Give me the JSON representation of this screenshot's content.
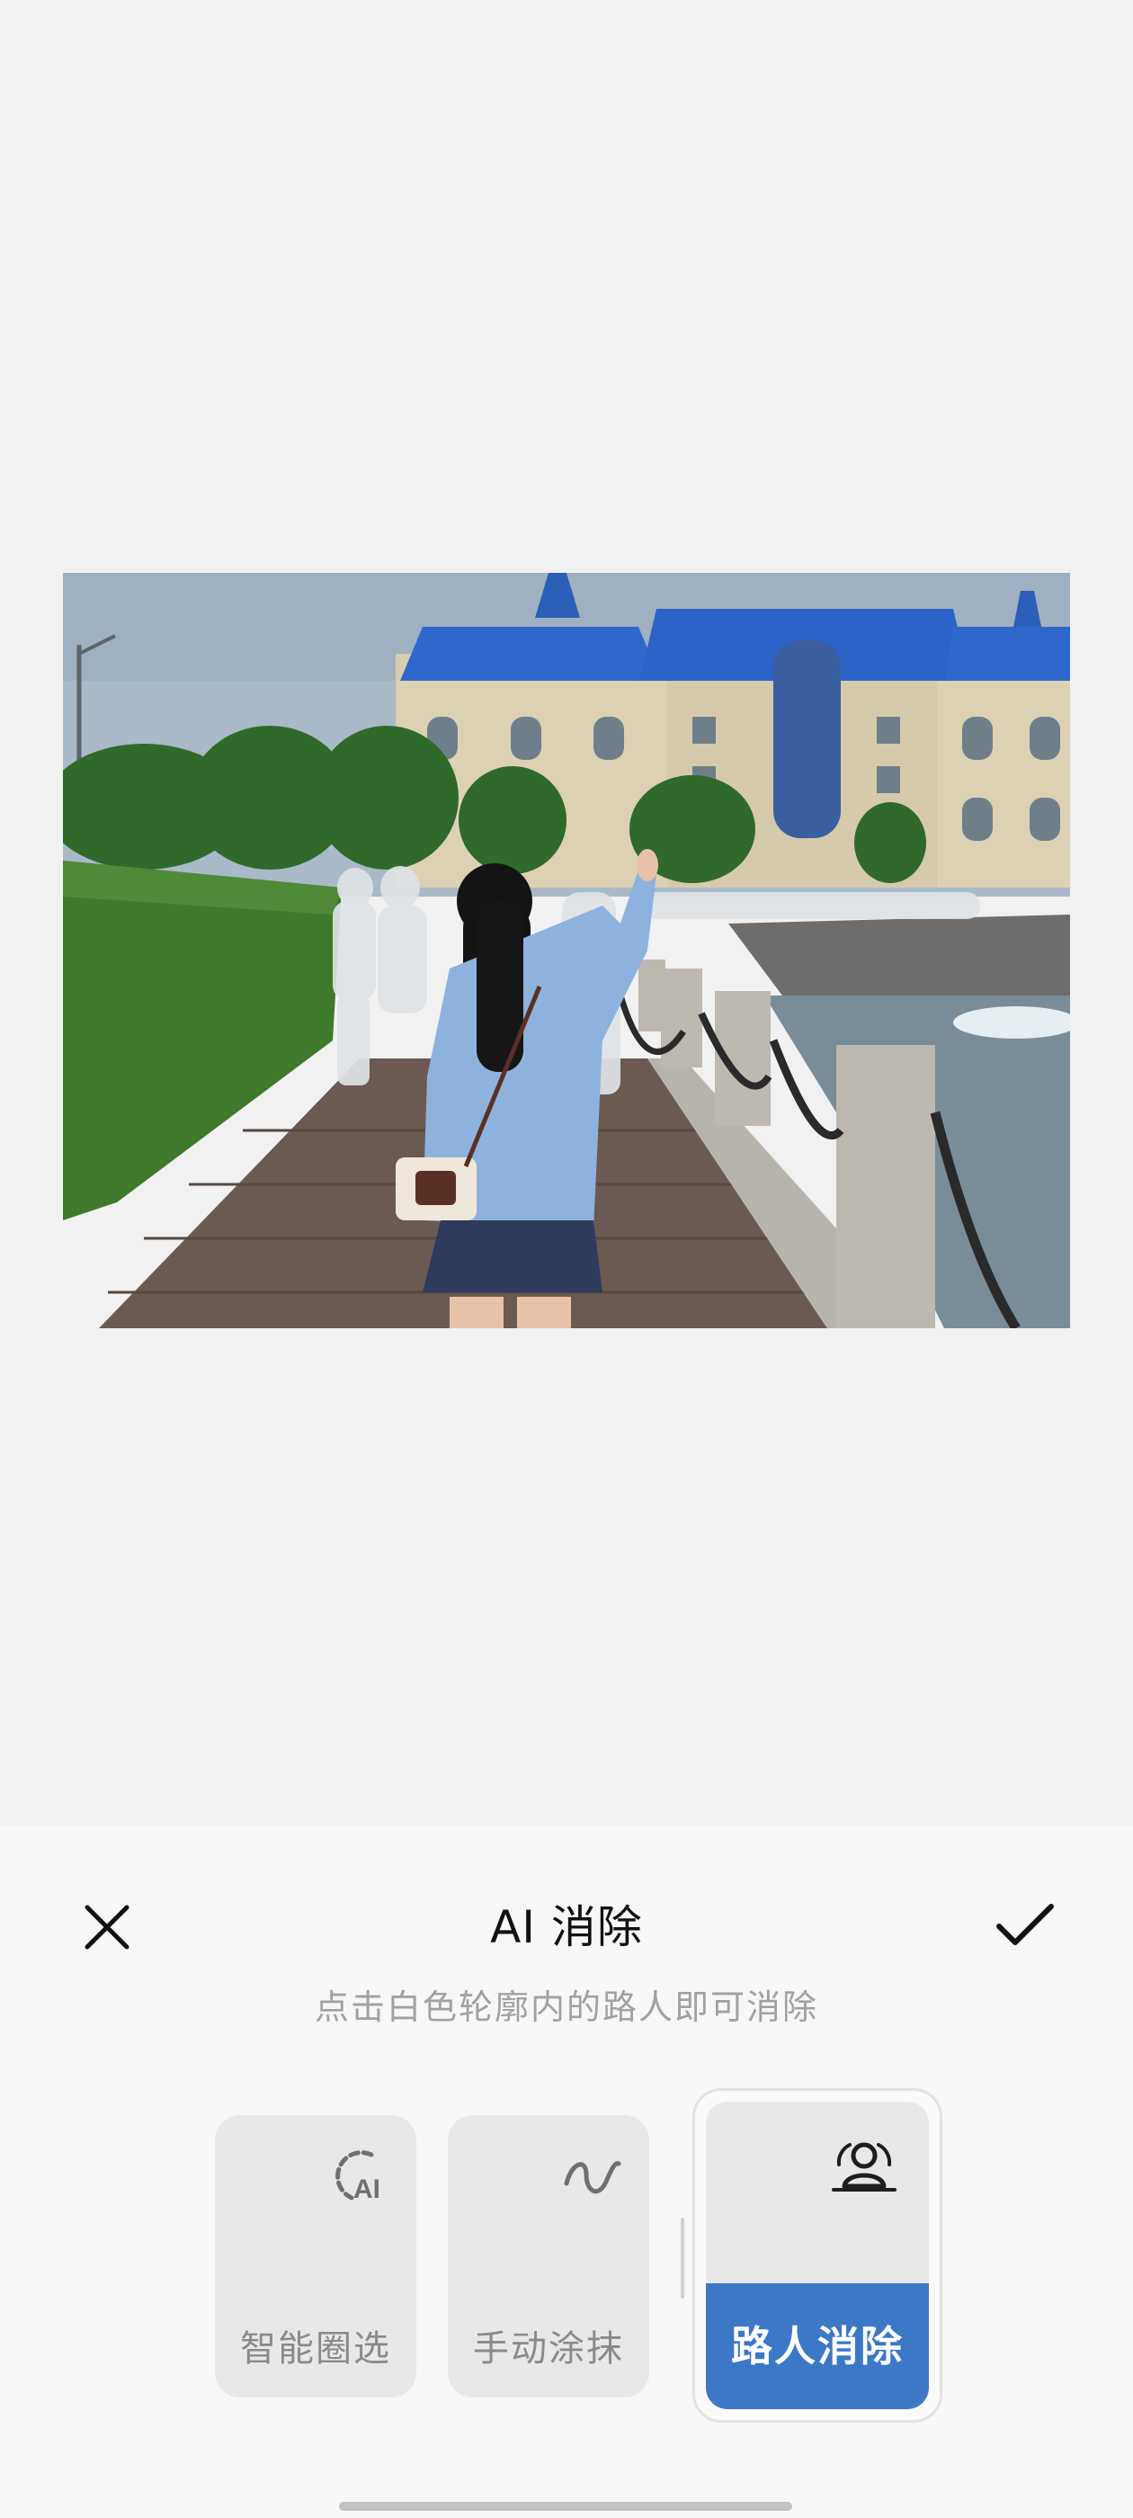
{
  "photo": {
    "alt": "",
    "sky": "#aab9c8",
    "roof": "#2b63c8",
    "facade": "#dcd0b2",
    "hedge": "#3f7a2c",
    "boardwalk": "#6a5a52",
    "water": "#7a8c98",
    "jacket": "#8eb2de",
    "hair": "#141414"
  },
  "panel": {
    "title": "AI 消除",
    "hint": "点击白色轮廓内的路人即可消除",
    "close_icon": "close-icon",
    "confirm_icon": "checkmark-icon"
  },
  "tools": {
    "smart": {
      "label": "智能圈选",
      "icon": "ai-lasso-icon"
    },
    "manual": {
      "label": "手动涂抹",
      "icon": "brush-stroke-icon"
    },
    "passerby": {
      "label": "路人消除",
      "icon": "passerby-icon",
      "selected": true
    }
  },
  "colors": {
    "accent": "#3c78c6",
    "background": "#f1f1f1",
    "panel": "#f7f7f7",
    "tile": "#e8e8e8",
    "hint_text": "#a1a1a1"
  }
}
